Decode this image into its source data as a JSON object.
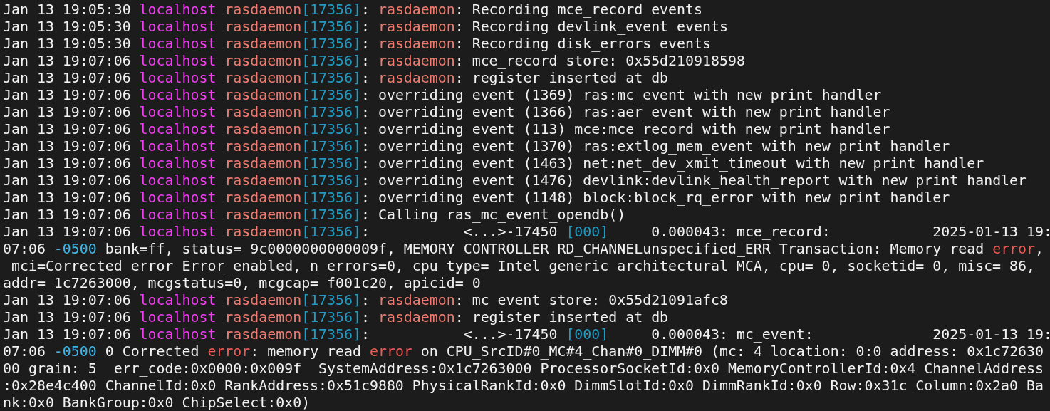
{
  "terminal": {
    "lines": [
      {
        "segments": [
          {
            "text": "Jan 13 19:05:30 ",
            "kind": "plain"
          },
          {
            "text": "localhost ",
            "kind": "host"
          },
          {
            "text": "rasdaemon",
            "kind": "proc"
          },
          {
            "text": "[17356]",
            "kind": "pid"
          },
          {
            "text": ": ",
            "kind": "plain"
          },
          {
            "text": "rasdaemon",
            "kind": "tag"
          },
          {
            "text": ": Recording mce_record events",
            "kind": "plain"
          }
        ]
      },
      {
        "segments": [
          {
            "text": "Jan 13 19:05:30 ",
            "kind": "plain"
          },
          {
            "text": "localhost ",
            "kind": "host"
          },
          {
            "text": "rasdaemon",
            "kind": "proc"
          },
          {
            "text": "[17356]",
            "kind": "pid"
          },
          {
            "text": ": ",
            "kind": "plain"
          },
          {
            "text": "rasdaemon",
            "kind": "tag"
          },
          {
            "text": ": Recording devlink_event events",
            "kind": "plain"
          }
        ]
      },
      {
        "segments": [
          {
            "text": "Jan 13 19:05:30 ",
            "kind": "plain"
          },
          {
            "text": "localhost ",
            "kind": "host"
          },
          {
            "text": "rasdaemon",
            "kind": "proc"
          },
          {
            "text": "[17356]",
            "kind": "pid"
          },
          {
            "text": ": ",
            "kind": "plain"
          },
          {
            "text": "rasdaemon",
            "kind": "tag"
          },
          {
            "text": ": Recording disk_errors events",
            "kind": "plain"
          }
        ]
      },
      {
        "segments": [
          {
            "text": "Jan 13 19:07:06 ",
            "kind": "plain"
          },
          {
            "text": "localhost ",
            "kind": "host"
          },
          {
            "text": "rasdaemon",
            "kind": "proc"
          },
          {
            "text": "[17356]",
            "kind": "pid"
          },
          {
            "text": ": ",
            "kind": "plain"
          },
          {
            "text": "rasdaemon",
            "kind": "tag"
          },
          {
            "text": ": mce_record store: 0x55d210918598",
            "kind": "plain"
          }
        ]
      },
      {
        "segments": [
          {
            "text": "Jan 13 19:07:06 ",
            "kind": "plain"
          },
          {
            "text": "localhost ",
            "kind": "host"
          },
          {
            "text": "rasdaemon",
            "kind": "proc"
          },
          {
            "text": "[17356]",
            "kind": "pid"
          },
          {
            "text": ": ",
            "kind": "plain"
          },
          {
            "text": "rasdaemon",
            "kind": "tag"
          },
          {
            "text": ": register inserted at db",
            "kind": "plain"
          }
        ]
      },
      {
        "segments": [
          {
            "text": "Jan 13 19:07:06 ",
            "kind": "plain"
          },
          {
            "text": "localhost ",
            "kind": "host"
          },
          {
            "text": "rasdaemon",
            "kind": "proc"
          },
          {
            "text": "[17356]",
            "kind": "pid"
          },
          {
            "text": ": overriding event (1369) ras:mc_event with new print handler",
            "kind": "plain"
          }
        ]
      },
      {
        "segments": [
          {
            "text": "Jan 13 19:07:06 ",
            "kind": "plain"
          },
          {
            "text": "localhost ",
            "kind": "host"
          },
          {
            "text": "rasdaemon",
            "kind": "proc"
          },
          {
            "text": "[17356]",
            "kind": "pid"
          },
          {
            "text": ": overriding event (1366) ras:aer_event with new print handler",
            "kind": "plain"
          }
        ]
      },
      {
        "segments": [
          {
            "text": "Jan 13 19:07:06 ",
            "kind": "plain"
          },
          {
            "text": "localhost ",
            "kind": "host"
          },
          {
            "text": "rasdaemon",
            "kind": "proc"
          },
          {
            "text": "[17356]",
            "kind": "pid"
          },
          {
            "text": ": overriding event (113) mce:mce_record with new print handler",
            "kind": "plain"
          }
        ]
      },
      {
        "segments": [
          {
            "text": "Jan 13 19:07:06 ",
            "kind": "plain"
          },
          {
            "text": "localhost ",
            "kind": "host"
          },
          {
            "text": "rasdaemon",
            "kind": "proc"
          },
          {
            "text": "[17356]",
            "kind": "pid"
          },
          {
            "text": ": overriding event (1370) ras:extlog_mem_event with new print handler",
            "kind": "plain"
          }
        ]
      },
      {
        "segments": [
          {
            "text": "Jan 13 19:07:06 ",
            "kind": "plain"
          },
          {
            "text": "localhost ",
            "kind": "host"
          },
          {
            "text": "rasdaemon",
            "kind": "proc"
          },
          {
            "text": "[17356]",
            "kind": "pid"
          },
          {
            "text": ": overriding event (1463) net:net_dev_xmit_timeout with new print handler",
            "kind": "plain"
          }
        ]
      },
      {
        "segments": [
          {
            "text": "Jan 13 19:07:06 ",
            "kind": "plain"
          },
          {
            "text": "localhost ",
            "kind": "host"
          },
          {
            "text": "rasdaemon",
            "kind": "proc"
          },
          {
            "text": "[17356]",
            "kind": "pid"
          },
          {
            "text": ": overriding event (1476) devlink:devlink_health_report with new print handler",
            "kind": "plain"
          }
        ]
      },
      {
        "segments": [
          {
            "text": "Jan 13 19:07:06 ",
            "kind": "plain"
          },
          {
            "text": "localhost ",
            "kind": "host"
          },
          {
            "text": "rasdaemon",
            "kind": "proc"
          },
          {
            "text": "[17356]",
            "kind": "pid"
          },
          {
            "text": ": overriding event (1148) block:block_rq_error with new print handler",
            "kind": "plain"
          }
        ]
      },
      {
        "segments": [
          {
            "text": "Jan 13 19:07:06 ",
            "kind": "plain"
          },
          {
            "text": "localhost ",
            "kind": "host"
          },
          {
            "text": "rasdaemon",
            "kind": "proc"
          },
          {
            "text": "[17356]",
            "kind": "pid"
          },
          {
            "text": ": Calling ras_mc_event_opendb()",
            "kind": "plain"
          }
        ]
      },
      {
        "segments": [
          {
            "text": "Jan 13 19:07:06 ",
            "kind": "plain"
          },
          {
            "text": "localhost ",
            "kind": "host"
          },
          {
            "text": "rasdaemon",
            "kind": "proc"
          },
          {
            "text": "[17356]",
            "kind": "pid"
          },
          {
            "text": ":           <...>-17450 ",
            "kind": "plain"
          },
          {
            "text": "[000]",
            "kind": "cpu"
          },
          {
            "text": "     0.000043: mce_record:            2025-01-13 19:",
            "kind": "plain"
          }
        ]
      },
      {
        "segments": [
          {
            "text": "07:06 ",
            "kind": "plain"
          },
          {
            "text": "-0500",
            "kind": "zone"
          },
          {
            "text": " bank=ff, status= 9c0000000000009f, MEMORY CONTROLLER RD_CHANNELunspecified_ERR Transaction: Memory read ",
            "kind": "plain"
          },
          {
            "text": "error",
            "kind": "error"
          },
          {
            "text": ",",
            "kind": "plain"
          }
        ]
      },
      {
        "segments": [
          {
            "text": " mci=Corrected_error Error_enabled, n_errors=0, cpu_type= Intel generic architectural MCA, cpu= 0, socketid= 0, misc= 86,",
            "kind": "plain"
          }
        ]
      },
      {
        "segments": [
          {
            "text": "addr= 1c7263000, mcgstatus=0, mcgcap= f001c20, apicid= 0",
            "kind": "plain"
          }
        ]
      },
      {
        "segments": [
          {
            "text": "Jan 13 19:07:06 ",
            "kind": "plain"
          },
          {
            "text": "localhost ",
            "kind": "host"
          },
          {
            "text": "rasdaemon",
            "kind": "proc"
          },
          {
            "text": "[17356]",
            "kind": "pid"
          },
          {
            "text": ": ",
            "kind": "plain"
          },
          {
            "text": "rasdaemon",
            "kind": "tag"
          },
          {
            "text": ": mc_event store: 0x55d21091afc8",
            "kind": "plain"
          }
        ]
      },
      {
        "segments": [
          {
            "text": "Jan 13 19:07:06 ",
            "kind": "plain"
          },
          {
            "text": "localhost ",
            "kind": "host"
          },
          {
            "text": "rasdaemon",
            "kind": "proc"
          },
          {
            "text": "[17356]",
            "kind": "pid"
          },
          {
            "text": ": ",
            "kind": "plain"
          },
          {
            "text": "rasdaemon",
            "kind": "tag"
          },
          {
            "text": ": register inserted at db",
            "kind": "plain"
          }
        ]
      },
      {
        "segments": [
          {
            "text": "Jan 13 19:07:06 ",
            "kind": "plain"
          },
          {
            "text": "localhost ",
            "kind": "host"
          },
          {
            "text": "rasdaemon",
            "kind": "proc"
          },
          {
            "text": "[17356]",
            "kind": "pid"
          },
          {
            "text": ":           <...>-17450 ",
            "kind": "plain"
          },
          {
            "text": "[000]",
            "kind": "cpu"
          },
          {
            "text": "     0.000043: mc_event:              2025-01-13 19:",
            "kind": "plain"
          }
        ]
      },
      {
        "segments": [
          {
            "text": "07:06 ",
            "kind": "plain"
          },
          {
            "text": "-0500",
            "kind": "zone"
          },
          {
            "text": " 0 Corrected ",
            "kind": "plain"
          },
          {
            "text": "error",
            "kind": "error"
          },
          {
            "text": ": memory read ",
            "kind": "plain"
          },
          {
            "text": "error",
            "kind": "error"
          },
          {
            "text": " on CPU_SrcID#0_MC#4_Chan#0_DIMM#0 (mc: 4 location: 0:0 address: 0x1c72630",
            "kind": "plain"
          }
        ]
      },
      {
        "segments": [
          {
            "text": "00 grain: 5  err_code:0x0000:0x009f  SystemAddress:0x1c7263000 ProcessorSocketId:0x0 MemoryControllerId:0x4 ChannelAddress",
            "kind": "plain"
          }
        ]
      },
      {
        "segments": [
          {
            "text": ":0x28e4c400 ChannelId:0x0 RankAddress:0x51c9880 PhysicalRankId:0x0 DimmSlotId:0x0 DimmRankId:0x0 Row:0x31c Column:0x2a0 Ba",
            "kind": "plain"
          }
        ]
      },
      {
        "segments": [
          {
            "text": "nk:0x0 BankGroup:0x0 ChipSelect:0x0)",
            "kind": "plain"
          }
        ]
      }
    ]
  }
}
